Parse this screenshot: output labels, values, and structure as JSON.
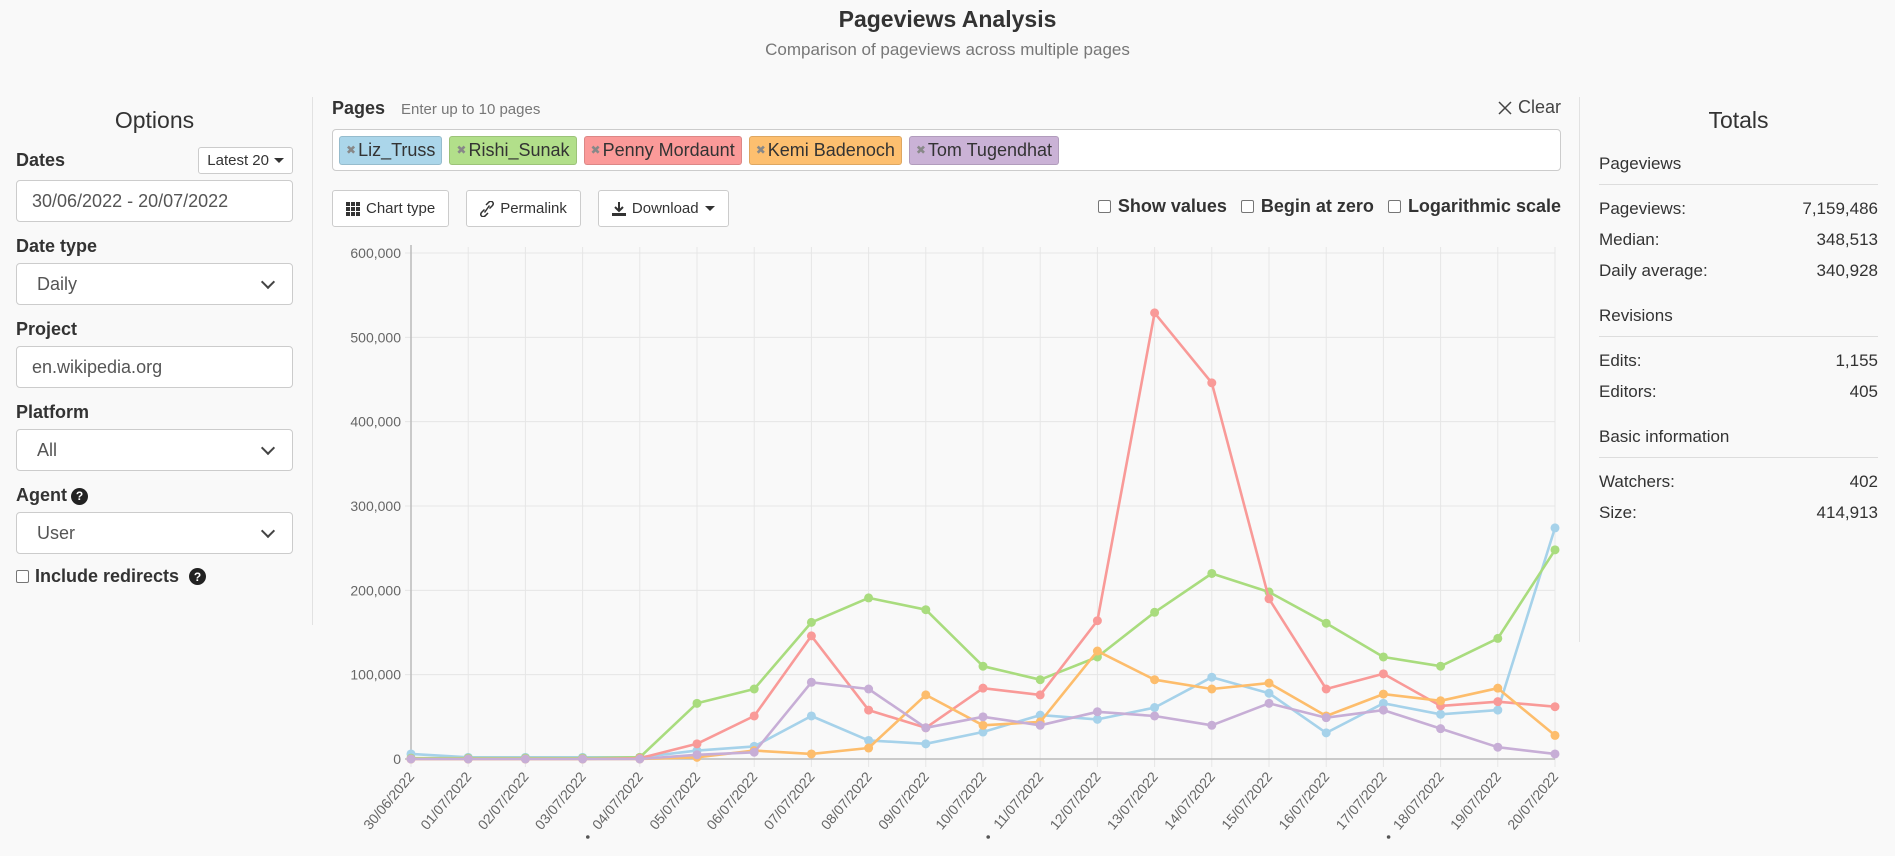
{
  "header": {
    "title": "Pageviews Analysis",
    "subtitle": "Comparison of pageviews across multiple pages"
  },
  "options": {
    "heading": "Options",
    "dates_label": "Dates",
    "latest_button": "Latest 20",
    "date_range": "30/06/2022 - 20/07/2022",
    "date_type_label": "Date type",
    "date_type_value": "Daily",
    "project_label": "Project",
    "project_value": "en.wikipedia.org",
    "platform_label": "Platform",
    "platform_value": "All",
    "agent_label": "Agent",
    "agent_value": "User",
    "include_redirects_label": "Include redirects",
    "include_redirects_checked": false
  },
  "pages": {
    "label": "Pages",
    "hint": "Enter up to 10 pages",
    "clear_label": "Clear",
    "tags": [
      {
        "name": "Liz_Truss",
        "color": "#abd6ea"
      },
      {
        "name": "Rishi_Sunak",
        "color": "#b2df8a"
      },
      {
        "name": "Penny Mordaunt",
        "color": "#fb9a99"
      },
      {
        "name": "Kemi Badenoch",
        "color": "#fdbf6f"
      },
      {
        "name": "Tom Tugendhat",
        "color": "#cab2d6"
      }
    ]
  },
  "toolbar": {
    "chart_type": "Chart type",
    "permalink": "Permalink",
    "download": "Download",
    "show_values": "Show values",
    "begin_at_zero": "Begin at zero",
    "log_scale": "Logarithmic scale"
  },
  "totals": {
    "heading": "Totals",
    "pageviews_section": "Pageviews",
    "pageviews_label": "Pageviews:",
    "pageviews_value": "7,159,486",
    "median_label": "Median:",
    "median_value": "348,513",
    "daily_avg_label": "Daily average:",
    "daily_avg_value": "340,928",
    "revisions_section": "Revisions",
    "edits_label": "Edits:",
    "edits_value": "1,155",
    "editors_label": "Editors:",
    "editors_value": "405",
    "basic_section": "Basic information",
    "watchers_label": "Watchers:",
    "watchers_value": "402",
    "size_label": "Size:",
    "size_value": "414,913"
  },
  "chart_data": {
    "type": "line",
    "title": "",
    "xlabel": "",
    "ylabel": "",
    "ylim": [
      0,
      600000
    ],
    "yticks": [
      0,
      100000,
      200000,
      300000,
      400000,
      500000,
      600000
    ],
    "ytick_labels": [
      "0",
      "100,000",
      "200,000",
      "300,000",
      "400,000",
      "500,000",
      "600,000"
    ],
    "grid": true,
    "legend": "none",
    "categories": [
      "30/06/2022",
      "01/07/2022",
      "02/07/2022",
      "03/07/2022",
      "04/07/2022",
      "05/07/2022",
      "06/07/2022",
      "07/07/2022",
      "08/07/2022",
      "09/07/2022",
      "10/07/2022",
      "11/07/2022",
      "12/07/2022",
      "13/07/2022",
      "14/07/2022",
      "15/07/2022",
      "16/07/2022",
      "17/07/2022",
      "18/07/2022",
      "19/07/2022",
      "20/07/2022"
    ],
    "weekend_markers": [
      "04/07/2022",
      "11/07/2022",
      "18/07/2022"
    ],
    "series": [
      {
        "name": "Liz_Truss",
        "color": "#a6d2ea",
        "values": [
          6000,
          2000,
          2000,
          2000,
          2000,
          10000,
          15000,
          51000,
          22000,
          18000,
          32000,
          52000,
          47000,
          61000,
          97000,
          78000,
          31000,
          66000,
          53000,
          58000,
          274000
        ]
      },
      {
        "name": "Rishi_Sunak",
        "color": "#a9dc7e",
        "values": [
          1000,
          1000,
          1000,
          1000,
          2000,
          66000,
          83000,
          162000,
          191000,
          177000,
          110000,
          94000,
          121000,
          174000,
          220000,
          198000,
          161000,
          121000,
          110000,
          143000,
          248000
        ]
      },
      {
        "name": "Penny Mordaunt",
        "color": "#f99a98",
        "values": [
          0,
          0,
          0,
          0,
          1000,
          18000,
          51000,
          146000,
          58000,
          37000,
          84000,
          76000,
          164000,
          529000,
          446000,
          190000,
          83000,
          101000,
          63000,
          68000,
          62000
        ]
      },
      {
        "name": "Kemi Badenoch",
        "color": "#fdbd6c",
        "values": [
          0,
          0,
          0,
          0,
          0,
          2000,
          10000,
          6000,
          13000,
          76000,
          40000,
          44000,
          128000,
          94000,
          83000,
          90000,
          51000,
          77000,
          69000,
          84000,
          28000
        ]
      },
      {
        "name": "Tom Tugendhat",
        "color": "#c7aed6",
        "values": [
          0,
          0,
          0,
          0,
          0,
          5000,
          8000,
          91000,
          83000,
          37000,
          50000,
          40000,
          56000,
          51000,
          40000,
          66000,
          49000,
          58000,
          36000,
          14000,
          6000
        ]
      }
    ]
  }
}
